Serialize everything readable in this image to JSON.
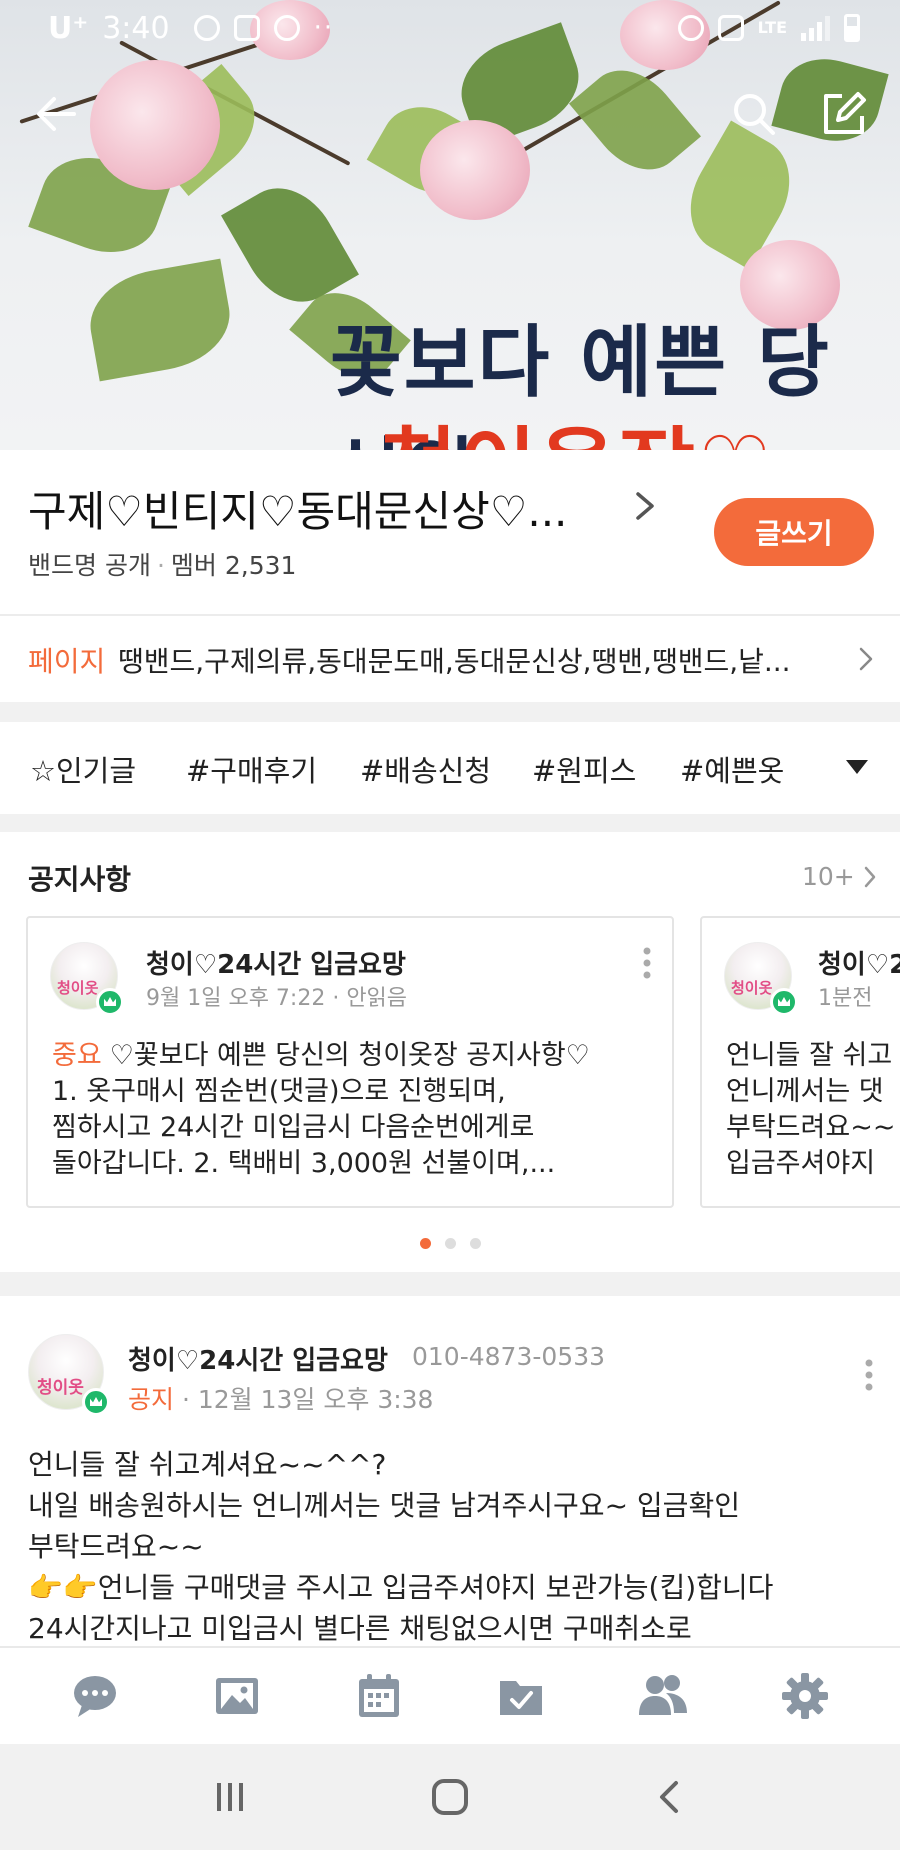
{
  "status_bar": {
    "carrier": "U⁺",
    "time": "3:40",
    "network": "LTE"
  },
  "cover": {
    "headline": "꽃보다 예쁜 당신의",
    "subline": "청이옷장♡"
  },
  "band": {
    "name": "구제♡빈티지♡동대문신상♡...",
    "visibility": "밴드명 공개",
    "members_label": "멤버 2,531",
    "write_button": "글쓰기"
  },
  "page_row": {
    "label": "페이지",
    "tags": "땡밴드,구제의류,동대문도매,동대문신상,땡밴,땡밴드,낱..."
  },
  "tags_row": {
    "items": [
      "☆인기글",
      "#구매후기",
      "#배송신청",
      "#원피스",
      "#예쁜옷"
    ]
  },
  "notice": {
    "title": "공지사항",
    "count": "10+",
    "cards": [
      {
        "author": "청이♡24시간 입금요망",
        "date": "9월 1일 오후 7:22 · 안읽음",
        "important": "중요",
        "lines": [
          "♡꽃보다 예쁜 당신의 청이옷장 공지사항♡",
          "1. 옷구매시 찜순번(댓글)으로 진행되며,",
          "찜하시고 24시간 미입금시 다음순번에게로",
          "돌아갑니다. 2. 택배비 3,000원 선불이며,..."
        ]
      },
      {
        "author": "청이♡2",
        "date": "1분전",
        "lines": [
          "언니들 잘 쉬고",
          "언니께서는 댓",
          "부탁드려요~~",
          "입금주셔야지"
        ]
      }
    ],
    "avatar_text": "청이옷"
  },
  "post": {
    "author": "청이♡24시간 입금요망",
    "phone": "010-4873-0533",
    "label": "공지",
    "date": "· 12월 13일 오후 3:38",
    "lines": [
      "언니들 잘 쉬고계셔요~~^^?",
      "내일 배송원하시는 언니께서는 댓글 남겨주시구요~ 입금확인",
      "부탁드려요~~",
      "👉👉언니들 구매댓글 주시고 입금주셔야지 보관가능(킵)합니다",
      "24시간지나고 미입금시 별다른 채팅없으시면 구매취소로"
    ]
  },
  "colors": {
    "accent": "#f36b3b",
    "crown_green": "#1fb86a",
    "nav_icon": "#8a96a3"
  }
}
